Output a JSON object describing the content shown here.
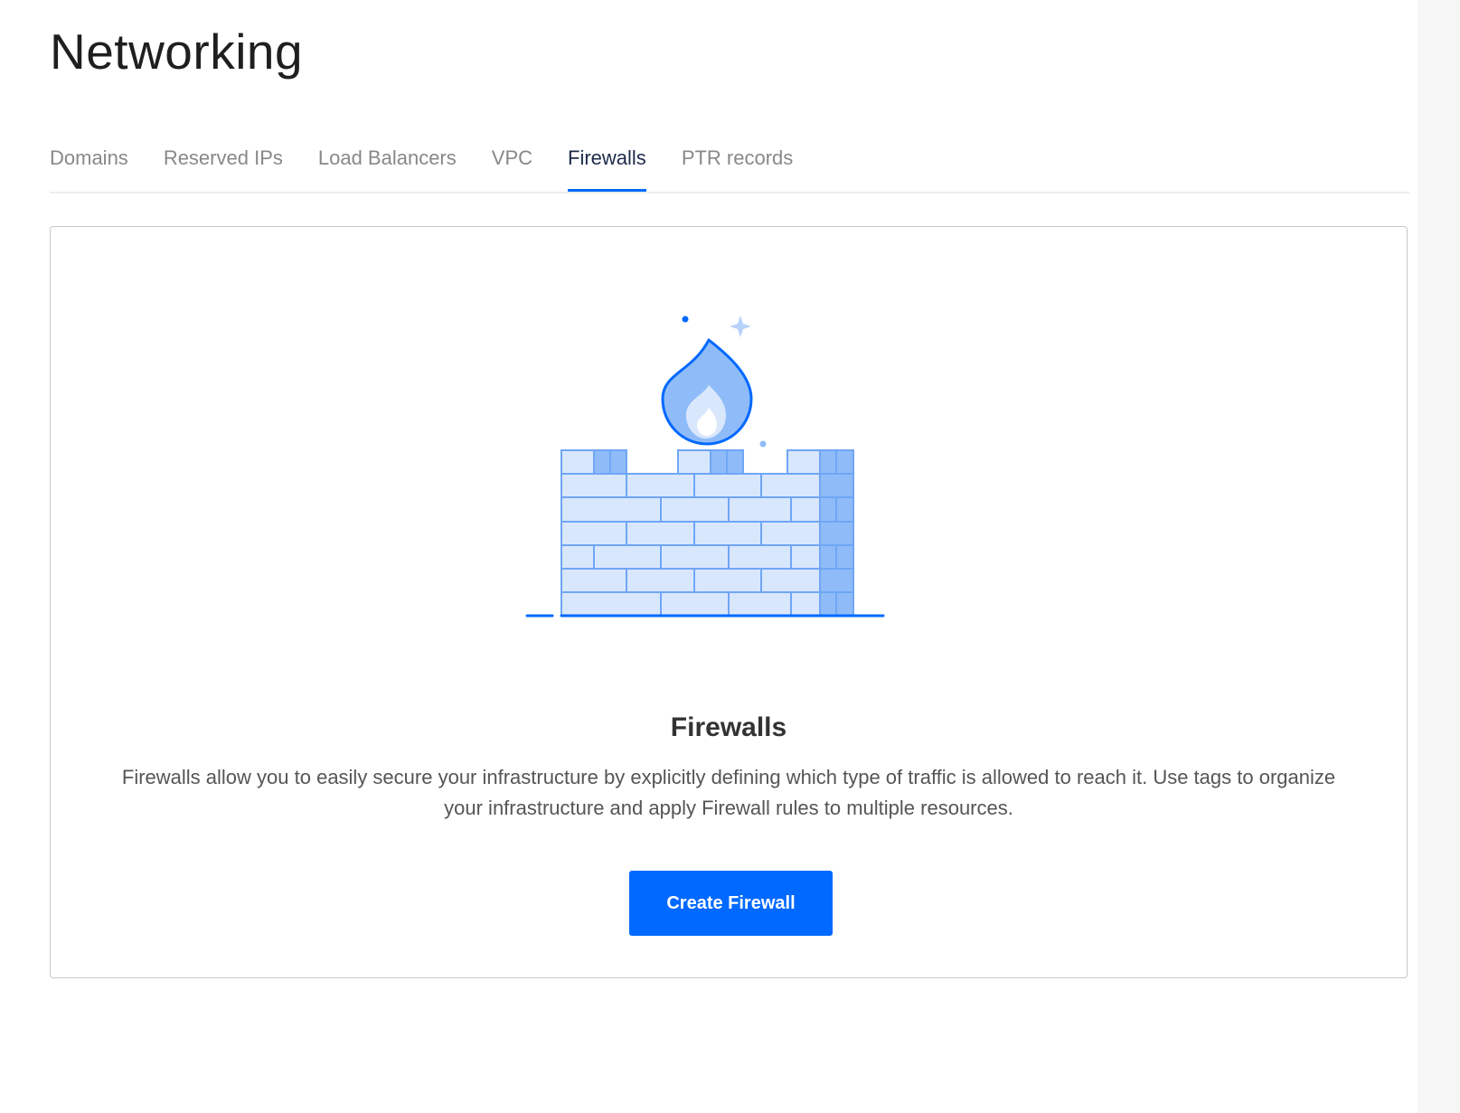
{
  "page": {
    "title": "Networking"
  },
  "tabs": [
    {
      "label": "Domains",
      "active": false
    },
    {
      "label": "Reserved IPs",
      "active": false
    },
    {
      "label": "Load Balancers",
      "active": false
    },
    {
      "label": "VPC",
      "active": false
    },
    {
      "label": "Firewalls",
      "active": true
    },
    {
      "label": "PTR records",
      "active": false
    }
  ],
  "empty_state": {
    "illustration_icon": "firewall-flame-icon",
    "title": "Firewalls",
    "description": "Firewalls allow you to easily secure your infrastructure by explicitly defining which type of traffic is allowed to reach it. Use tags to organize your infrastructure and apply Firewall rules to multiple resources.",
    "button_label": "Create Firewall"
  },
  "colors": {
    "accent": "#0069ff",
    "brick_light": "#d9e7fd",
    "brick_dark": "#8fbcf8",
    "flame_fill": "#8fbcf8",
    "outline": "#0069ff"
  }
}
